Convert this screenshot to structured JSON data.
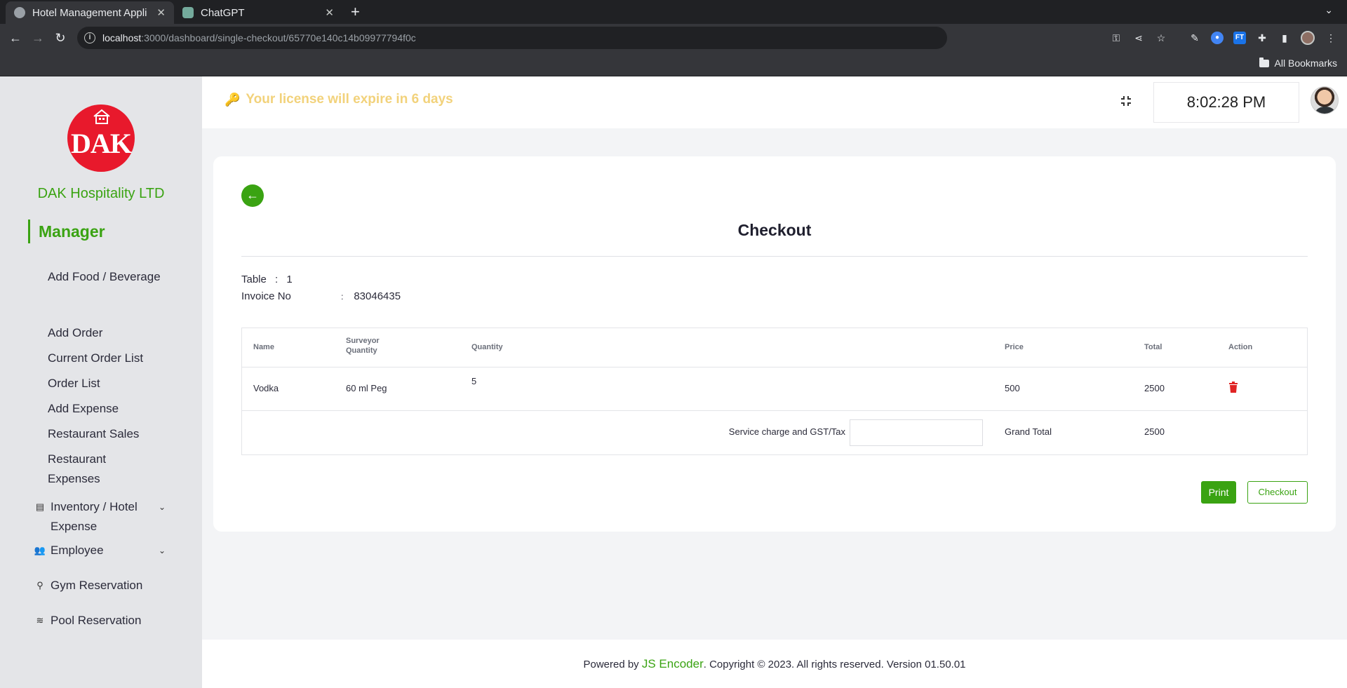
{
  "browser": {
    "tabs": [
      {
        "title": "Hotel Management Appli",
        "active": true
      },
      {
        "title": "ChatGPT",
        "active": false
      }
    ],
    "url_host": "localhost",
    "url_rest": ":3000/dashboard/single-checkout/65770e140c14b09977794f0c",
    "bookmarks_label": "All Bookmarks"
  },
  "sidebar": {
    "logo_text": "DAK",
    "company": "DAK Hospitality LTD",
    "role": "Manager",
    "items": [
      {
        "label": "Add Food / Beverage"
      },
      {
        "label": "Add Order"
      },
      {
        "label": "Current Order List"
      },
      {
        "label": "Order List"
      },
      {
        "label": "Add Expense"
      },
      {
        "label": "Restaurant Sales"
      },
      {
        "label": "Restaurant Expenses"
      }
    ],
    "groups": [
      {
        "label": "Inventory / Hotel Expense",
        "icon": "archive-icon"
      },
      {
        "label": "Employee",
        "icon": "users-icon"
      },
      {
        "label": "Gym Reservation",
        "icon": "gym-icon"
      },
      {
        "label": "Pool Reservation",
        "icon": "pool-icon"
      }
    ]
  },
  "header": {
    "license_text": "Your license will expire in 6 days",
    "clock": "8:02:28 PM"
  },
  "checkout": {
    "title": "Checkout",
    "table_label": "Table",
    "table_sep": ":",
    "table_value": "1",
    "invoice_label": "Invoice No",
    "invoice_sep": ":",
    "invoice_value": "83046435",
    "columns": {
      "name": "Name",
      "surveyor_line1": "Surveyor",
      "surveyor_line2": "Quantity",
      "quantity": "Quantity",
      "price": "Price",
      "total": "Total",
      "action": "Action"
    },
    "rows": [
      {
        "name": "Vodka",
        "surveyor_quantity": "60 ml Peg",
        "quantity": "5",
        "price": "500",
        "total": "2500"
      }
    ],
    "tax_label": "Service charge and GST/Tax",
    "tax_value": "",
    "grand_total_label": "Grand Total",
    "grand_total_value": "2500",
    "print_label": "Print",
    "checkout_label": "Checkout"
  },
  "footer": {
    "prefix": "Powered by ",
    "brand": "JS Encoder",
    "suffix": ". Copyright © 2023. All rights reserved. Version 01.50.01"
  },
  "colors": {
    "accent": "#3aa312",
    "license": "#f2d27b",
    "logo": "#e8192c",
    "danger": "#e02424"
  }
}
